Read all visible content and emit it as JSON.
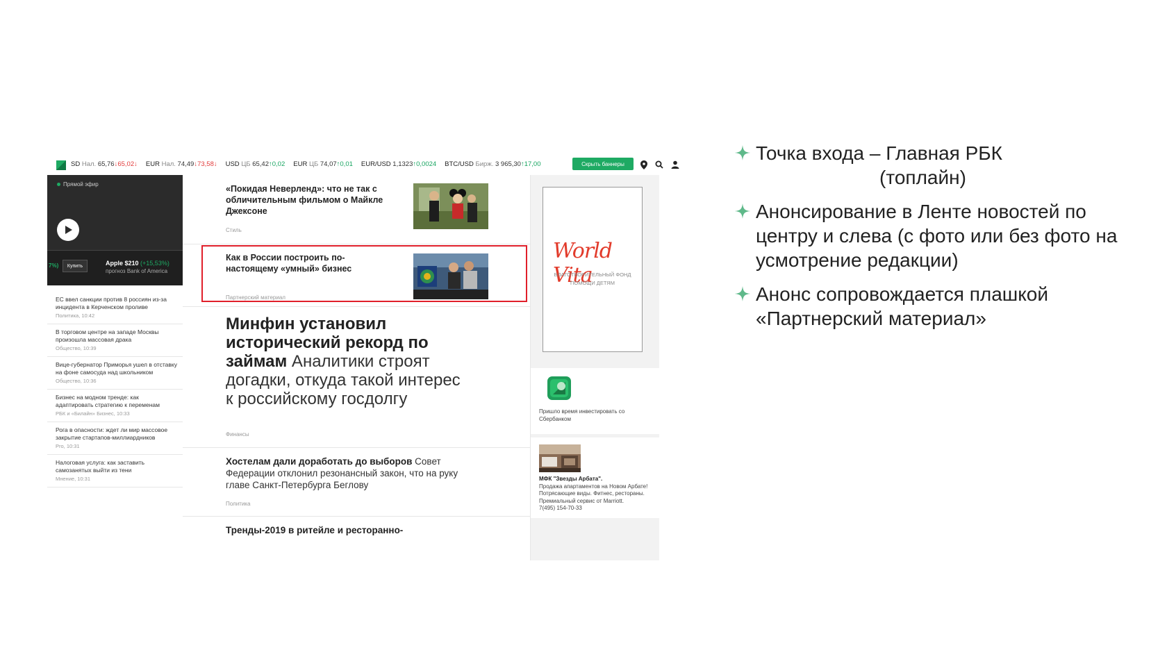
{
  "ticker": {
    "items": [
      {
        "label": "SD",
        "sub": "Нал.",
        "v1": "65,76",
        "a1": "↓",
        "c1": "dn",
        "v2": "65,02",
        "a2": "↓"
      },
      {
        "label": "EUR",
        "sub": "Нал.",
        "v1": "74,49",
        "a1": "↓",
        "c1": "dn",
        "v2": "73,58",
        "a2": "↓"
      },
      {
        "label": "USD",
        "sub": "ЦБ",
        "v1": "65,42",
        "a1": "↑",
        "c1": "up",
        "v2": "0,02",
        "a2": ""
      },
      {
        "label": "EUR",
        "sub": "ЦБ",
        "v1": "74,07",
        "a1": "↑",
        "c1": "up",
        "v2": "0,01",
        "a2": ""
      },
      {
        "label": "EUR/USD",
        "sub": "",
        "v1": "1,1323",
        "a1": "↑",
        "c1": "up",
        "v2": "0,0024",
        "a2": ""
      },
      {
        "label": "BTC/USD",
        "sub": "Бирж.",
        "v1": "3 965,30",
        "a1": "↑",
        "c1": "up",
        "v2": "17,00",
        "a2": ""
      }
    ],
    "hide_banners": "Скрыть баннеры"
  },
  "live": {
    "label": "Прямой эфир",
    "pct": "7%)",
    "buy": "Купить",
    "apple": "Apple $210",
    "apple_change": "(+15,53%)",
    "forecast": "прогноз Bank of America"
  },
  "left_news": [
    {
      "title": "ЕС ввел санкции против 8 россиян из-за инцидента в Керченском проливе",
      "meta": "Политика, 10:42"
    },
    {
      "title": "В торговом центре на западе Москвы произошла массовая драка",
      "meta": "Общество, 10:39"
    },
    {
      "title": "Вице-губернатор Приморья ушел в отставку на фоне самосуда над школьником",
      "meta": "Общество, 10:36"
    },
    {
      "title": "Бизнес на модном тренде: как адаптировать стратегию к переменам",
      "meta": "РБК и «Билайн» Бизнес, 10:33"
    },
    {
      "title": "Рога в опасности: ждет ли мир массовое закрытие стартапов-миллиардников",
      "meta": "Pro, 10:31"
    },
    {
      "title": "Налоговая услуга: как заставить самозанятых выйти из тени",
      "meta": "Мнение, 10:31"
    }
  ],
  "center": {
    "a1_title": "«Покидая Неверленд»: что не так с обличительным фильмом о Майкле Джексоне",
    "a1_tag": "Стиль",
    "a2_title": "Как в России построить по-настоящему «умный» бизнес",
    "a2_tag": "Партнерский материал",
    "a3_bold": "Минфин установил исторический рекорд по займам",
    "a3_rest": " Аналитики строят догадки, откуда такой интерес к российскому госдолгу",
    "a3_tag": "Финансы",
    "a4_bold": "Хостелам дали доработать до выборов",
    "a4_rest": " Совет Федерации отклонил резонансный закон, что на руку главе Санкт-Петербурга Беглову",
    "a4_tag": "Политика",
    "a5_bold": "Тренды-2019 в ритейле и ресторанно-"
  },
  "right": {
    "banner_logo": "World Vita",
    "banner_sub": "БЛАГОТВОРИТЕЛЬНЫЙ ФОНД ПОМОЩИ ДЕТЯМ",
    "promo1": "Пришло время инвестировать со Сбербанком",
    "promo2_title": "МФК \"Звезды Арбата\".",
    "promo2_text": "Продажа апартаментов на Новом Арбате! Потрясающие виды. Фитнес, рестораны. Премиальный сервис от Marriott.",
    "promo2_phone": "7(495) 154-70-33"
  },
  "bullets": [
    {
      "line1": "Точка входа – Главная РБК",
      "line2": "(топлайн)"
    },
    {
      "text": "Анонсирование в Ленте новостей по центру и слева (с фото или без фото на усмотрение редакции)"
    },
    {
      "text": "Анонс сопровождается плашкой «Партнерский материал»"
    }
  ],
  "colors": {
    "accent": "#1eaa63",
    "highlight": "#e01f2a",
    "star": "#5fb98a"
  }
}
